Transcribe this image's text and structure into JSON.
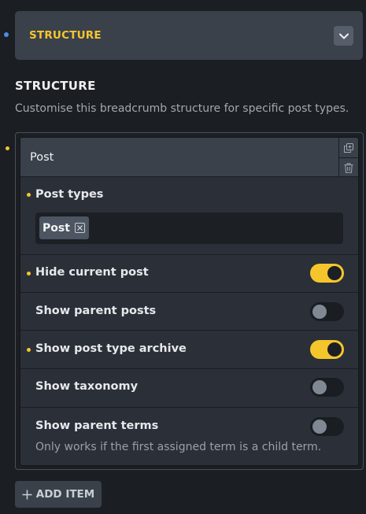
{
  "section": {
    "title": "STRUCTURE",
    "collapse_icon": "chevron-down-icon"
  },
  "group": {
    "title": "STRUCTURE",
    "description": "Customise this breadcrumb structure for specific post types."
  },
  "item": {
    "title": "Post",
    "actions": [
      "duplicate-icon",
      "trash-icon"
    ],
    "post_types": {
      "label": "Post types",
      "selected": [
        {
          "label": "Post"
        }
      ]
    },
    "hide_current_post": {
      "label": "Hide current post",
      "on": true
    },
    "show_parent_posts": {
      "label": "Show parent posts",
      "on": false
    },
    "show_post_type_archive": {
      "label": "Show post type archive",
      "on": true
    },
    "show_taxonomy": {
      "label": "Show taxonomy",
      "on": false
    },
    "show_parent_terms": {
      "label": "Show parent terms",
      "on": false,
      "hint": "Only works if the first assigned term is a child term."
    }
  },
  "add_item_label": "ADD ITEM",
  "colors": {
    "accent": "#f5c62c",
    "panel": "#3a414b",
    "background": "#1b1e22",
    "indicator_blue": "#4c8de3"
  }
}
